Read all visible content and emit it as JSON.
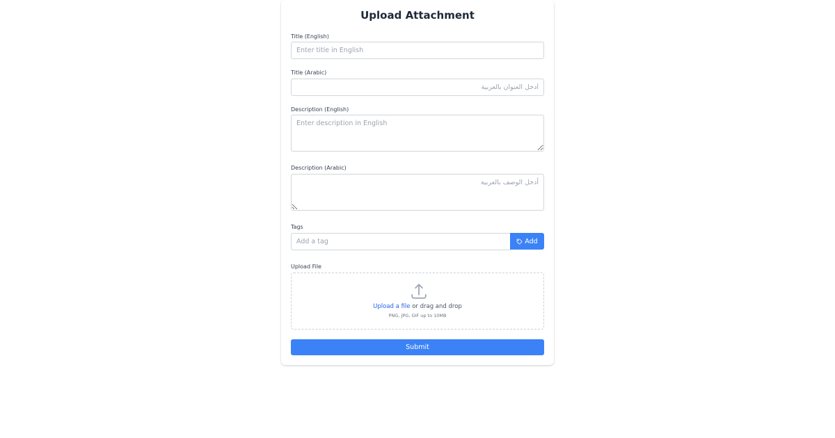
{
  "form": {
    "title": "Upload Attachment",
    "title_en": {
      "label": "Title (English)",
      "placeholder": "Enter title in English",
      "value": ""
    },
    "title_ar": {
      "label": "Title (Arabic)",
      "placeholder": "أدخل العنوان بالعربية",
      "value": ""
    },
    "description_en": {
      "label": "Description (English)",
      "placeholder": "Enter description in English",
      "value": ""
    },
    "description_ar": {
      "label": "Description (Arabic)",
      "placeholder": "أدخل الوصف بالعربية",
      "value": ""
    },
    "tags": {
      "label": "Tags",
      "placeholder": "Add a tag",
      "add_label": "Add",
      "add_icon": "tag-icon"
    },
    "upload": {
      "label": "Upload File",
      "icon": "upload-icon",
      "link_text": "Upload a file",
      "drag_text": "or drag and drop",
      "hint": "PNG, JPG, GIF up to 10MB"
    },
    "submit_label": "Submit"
  },
  "colors": {
    "accent": "#3b82f6",
    "link": "#2563eb",
    "border": "#d1d5db",
    "placeholder": "#9ca3af"
  }
}
